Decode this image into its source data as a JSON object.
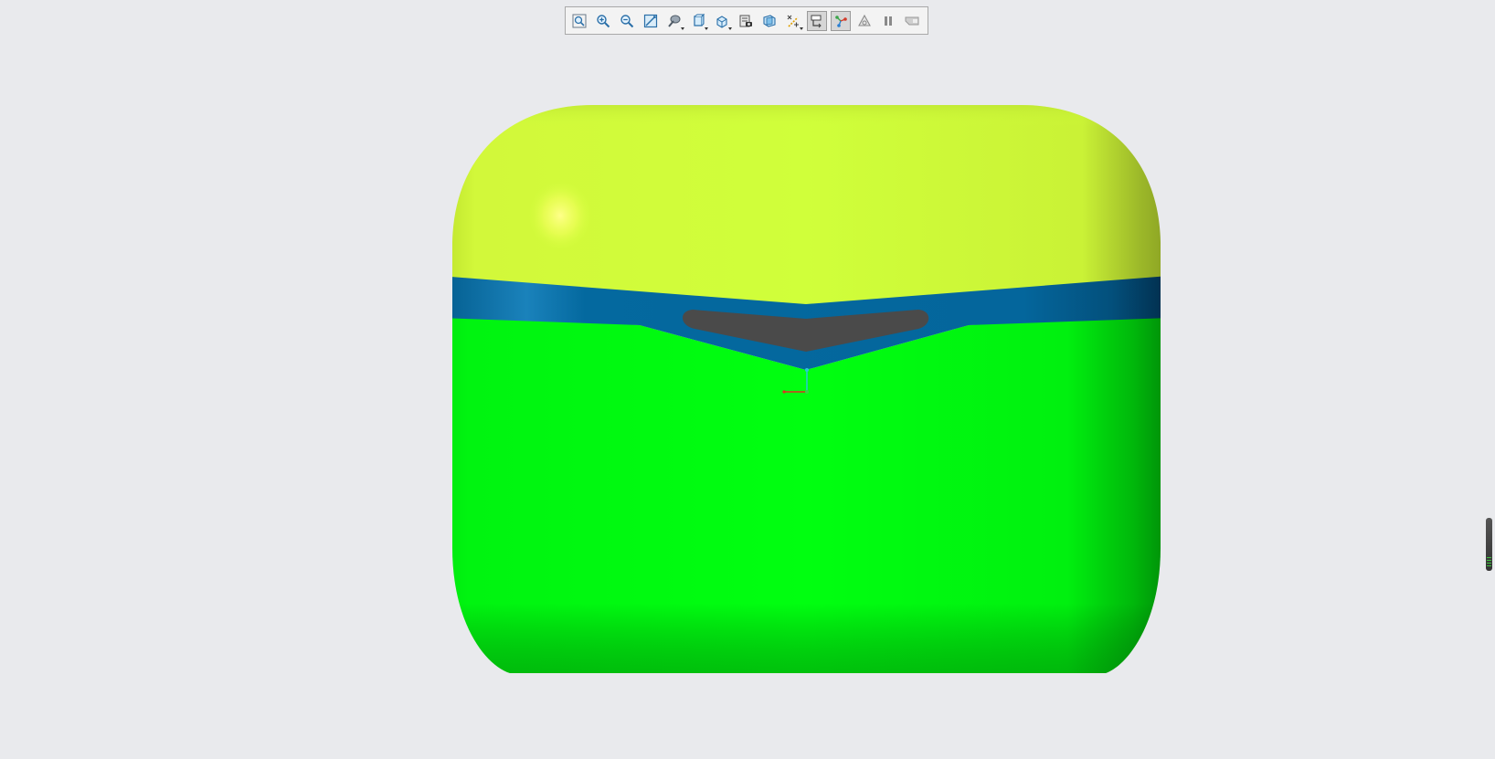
{
  "toolbar": {
    "buttons": [
      {
        "name": "refit-icon",
        "active": false,
        "dropdown": false
      },
      {
        "name": "zoom-in-icon",
        "active": false,
        "dropdown": false
      },
      {
        "name": "zoom-out-icon",
        "active": false,
        "dropdown": false
      },
      {
        "name": "repaint-icon",
        "active": false,
        "dropdown": false
      },
      {
        "name": "view-manager-icon",
        "active": false,
        "dropdown": true
      },
      {
        "name": "display-style-icon",
        "active": false,
        "dropdown": true
      },
      {
        "name": "saved-orientations-icon",
        "active": false,
        "dropdown": true
      },
      {
        "name": "perspective-icon",
        "active": false,
        "dropdown": false
      },
      {
        "name": "section-view-icon",
        "active": false,
        "dropdown": false
      },
      {
        "name": "datum-display-icon",
        "active": false,
        "dropdown": true
      },
      {
        "name": "annotation-display-icon",
        "active": true,
        "dropdown": false
      },
      {
        "name": "spin-center-icon",
        "active": true,
        "dropdown": false
      },
      {
        "name": "simulation-icon",
        "active": false,
        "dropdown": false
      },
      {
        "name": "pause-icon",
        "active": false,
        "dropdown": false
      },
      {
        "name": "filter-icon",
        "active": false,
        "dropdown": false
      }
    ]
  },
  "colors": {
    "background": "#e9eaed",
    "lid": "#d2ff3a",
    "band": "#04699f",
    "body": "#00ff10",
    "slot": "#4a4a4a",
    "axis_x": "#e03020",
    "axis_y": "#27c7d8",
    "axis_origin": "#3ad14a"
  }
}
